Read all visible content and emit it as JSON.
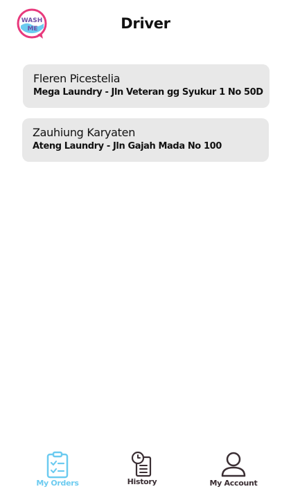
{
  "header": {
    "logo_text_top": "WASH",
    "logo_text_bottom": "ME",
    "title": "Driver"
  },
  "orders": [
    {
      "customer_name": "Fleren Picestelia",
      "laundry_address": "Mega Laundry - Jln Veteran gg Syukur 1 No 50D"
    },
    {
      "customer_name": "Zauhiung Karyaten",
      "laundry_address": "Ateng Laundry - Jln Gajah Mada No 100"
    }
  ],
  "bottom_nav": {
    "items": [
      {
        "label": "My Orders",
        "icon": "clipboard-check-icon",
        "active": true
      },
      {
        "label": "History",
        "icon": "history-clock-icon",
        "active": false
      },
      {
        "label": "My Account",
        "icon": "user-icon",
        "active": false
      }
    ]
  },
  "colors": {
    "brand_pink": "#e8397c",
    "brand_blue": "#6ccbf0",
    "card_background": "#e8e8e8",
    "nav_inactive": "#3a2e33"
  }
}
